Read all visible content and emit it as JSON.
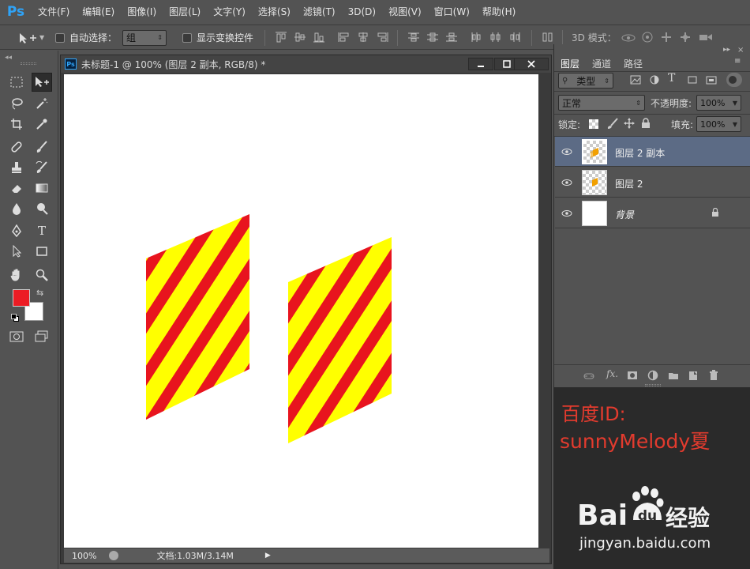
{
  "app": {
    "logo": "Ps"
  },
  "menu": [
    "文件(F)",
    "编辑(E)",
    "图像(I)",
    "图层(L)",
    "文字(Y)",
    "选择(S)",
    "滤镜(T)",
    "3D(D)",
    "视图(V)",
    "窗口(W)",
    "帮助(H)"
  ],
  "options": {
    "auto_select_label": "自动选择：",
    "auto_select_value": "组",
    "show_transform_label": "显示变换控件",
    "mode_3d_label": "3D 模式："
  },
  "document": {
    "title": "未标题-1 @ 100% (图层 2 副本, RGB/8) *",
    "zoom": "100%",
    "doc_info": "文档:1.03M/3.14M"
  },
  "colors": {
    "foreground": "#ec1c24",
    "background": "#ffffff",
    "stripe_yellow": "#ffff00",
    "stripe_red": "#e8141e",
    "selection": "#5c6b85",
    "watermark_text": "#e23b2e"
  },
  "panel": {
    "tabs": [
      "图层",
      "通道",
      "路径"
    ],
    "filter_kind": "类型",
    "blend_mode": "正常",
    "opacity_label": "不透明度:",
    "opacity_value": "100%",
    "lock_label": "锁定:",
    "fill_label": "填充:",
    "fill_value": "100%",
    "layers": [
      {
        "name": "图层 2 副本",
        "selected": true
      },
      {
        "name": "图层 2",
        "selected": false
      },
      {
        "name": "背景",
        "selected": false,
        "locked": true
      }
    ]
  },
  "watermark": {
    "line1": "百度ID:",
    "line2": "sunnyMelody夏",
    "brand": "Bai",
    "brand2": "经验",
    "site": "jingyan.baidu.com"
  }
}
